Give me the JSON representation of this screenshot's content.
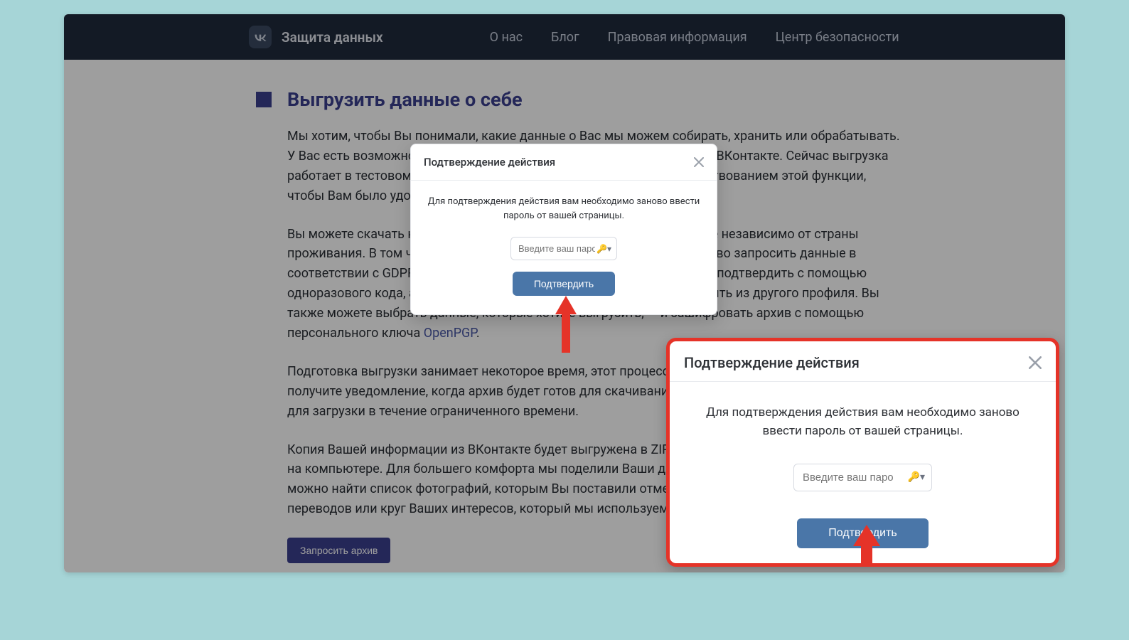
{
  "header": {
    "brand": "Защита данных",
    "nav": [
      "О нас",
      "Блог",
      "Правовая информация",
      "Центр безопасности"
    ]
  },
  "page": {
    "h1": "Выгрузить данные о себе",
    "p1": "Мы хотим, чтобы Вы понимали, какие данные о Вас мы можем собирать, хранить или обрабатывать. У Вас есть возможность выгрузить копию Ваших данных, хранящихся ВКонтакте. Сейчас выгрузка работает в тестовом режиме — мы активно работаем над усовершенствованием этой функции, чтобы Вам было удобно.",
    "p2a": "Вы можете скачать копию данных Вашего личного профиля ВКонтакте независимо от страны проживания. В том числе таким образом можно реализовать своё право запросить данные в соответствии с GDPR. Для Вашей безопасности каждый запрос нужно подтвердить с помощью одноразового кода, а ссылку на скачивание архива невозможно открыть из другого профиля. Вы также можете выбрать данные, которые хотите выгрузить, — и зашифровать архив с помощью персонального ключа ",
    "p2link": "OpenPGP",
    "p2b": ".",
    "p3": "Подготовка выгрузки занимает некоторое время, этот процесс происходит в фоновом режиме. Вы получите уведомление, когда архив будет готов для скачивания. Учтите, что архив будет доступен для загрузки в течение ограниченного времени.",
    "p4": "Копия Вашей информации из ВКонтакте будет выгружена в ZIP-архиве, содержимое удобно смотреть на компьютере. Для большего комфорта мы поделили Ваши данные на разделы. Например, легко можно найти список фотографий, которым Вы поставили отметку «Нравится», историю денежных переводов или круг Ваших интересов, который мы используем для показа рекламных объявлений.",
    "request_btn": "Запросить архив"
  },
  "modal": {
    "title": "Подтверждение действия",
    "msg": "Для подтверждения действия вам необходимо заново ввести пароль от вашей страницы.",
    "placeholder": "Введите ваш паро",
    "confirm": "Подтвердить"
  }
}
